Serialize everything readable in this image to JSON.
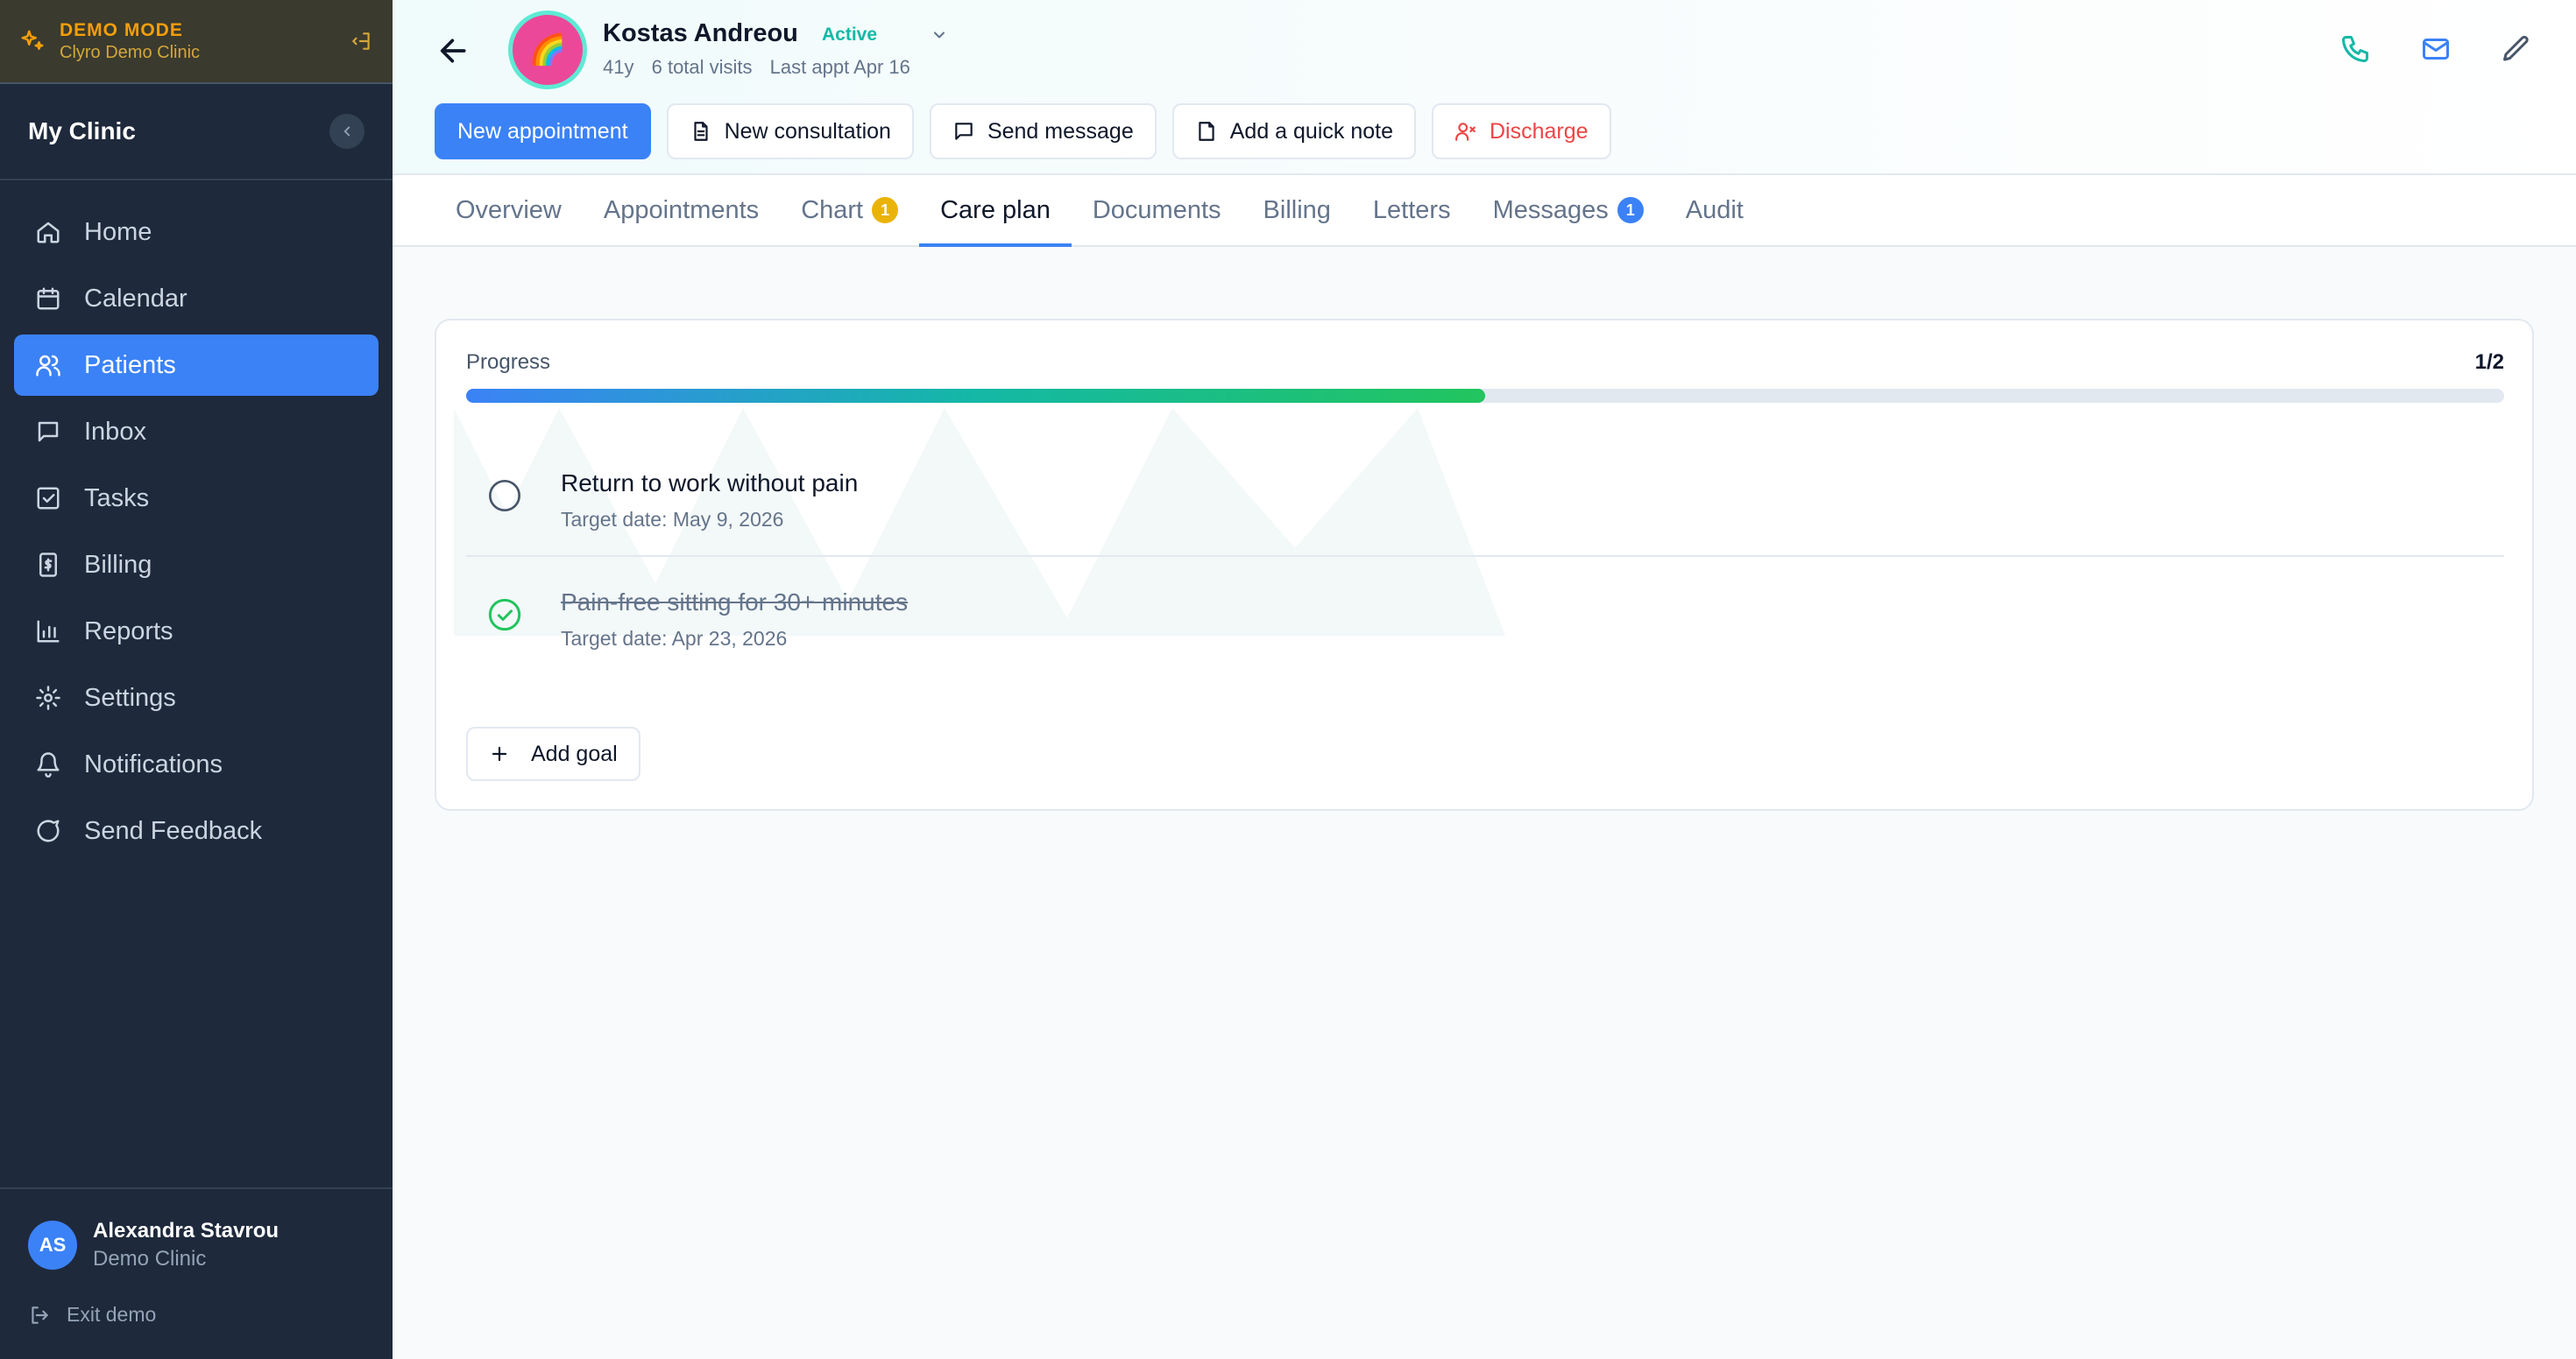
{
  "demo": {
    "title": "DEMO MODE",
    "subtitle": "Clyro Demo Clinic"
  },
  "sidebar": {
    "clinic": "My Clinic",
    "items": [
      {
        "label": "Home",
        "icon": "home-icon"
      },
      {
        "label": "Calendar",
        "icon": "calendar-icon"
      },
      {
        "label": "Patients",
        "icon": "users-icon",
        "active": true
      },
      {
        "label": "Inbox",
        "icon": "inbox-icon"
      },
      {
        "label": "Tasks",
        "icon": "tasks-icon"
      },
      {
        "label": "Billing",
        "icon": "billing-icon"
      },
      {
        "label": "Reports",
        "icon": "reports-icon"
      },
      {
        "label": "Settings",
        "icon": "settings-icon"
      },
      {
        "label": "Notifications",
        "icon": "bell-icon"
      },
      {
        "label": "Send Feedback",
        "icon": "feedback-icon"
      }
    ],
    "user": {
      "initials": "AS",
      "name": "Alexandra Stavrou",
      "clinic": "Demo Clinic"
    },
    "exit_label": "Exit demo"
  },
  "patient": {
    "name": "Kostas Andreou",
    "status": "Active",
    "age": "41y",
    "visits": "6 total visits",
    "last_appt": "Last appt Apr 16",
    "avatar_emoji": "🌈"
  },
  "actions": {
    "new_appointment": "New appointment",
    "new_consultation": "New consultation",
    "send_message": "Send message",
    "quick_note": "Add a quick note",
    "discharge": "Discharge"
  },
  "tabs": [
    {
      "label": "Overview"
    },
    {
      "label": "Appointments"
    },
    {
      "label": "Chart",
      "badge": "1",
      "badge_color": "#eab308"
    },
    {
      "label": "Care plan",
      "active": true
    },
    {
      "label": "Documents"
    },
    {
      "label": "Billing"
    },
    {
      "label": "Letters"
    },
    {
      "label": "Messages",
      "badge": "1",
      "badge_color": "#3b82f6"
    },
    {
      "label": "Audit"
    }
  ],
  "care_plan": {
    "progress_label": "Progress",
    "progress_count": "1/2",
    "progress_fraction": 0.5,
    "goals": [
      {
        "title": "Return to work without pain",
        "target": "Target date: May 9, 2026",
        "done": false
      },
      {
        "title": "Pain-free sitting for 30+ minutes",
        "target": "Target date: Apr 23, 2026",
        "done": true
      }
    ],
    "add_goal_label": "Add goal"
  },
  "colors": {
    "accent": "#3b82f6",
    "sidebar_bg": "#1e293b",
    "status_active": "#14b8a6",
    "danger": "#ef4444",
    "success": "#22c55e",
    "demo_accent": "#f59e0b"
  }
}
